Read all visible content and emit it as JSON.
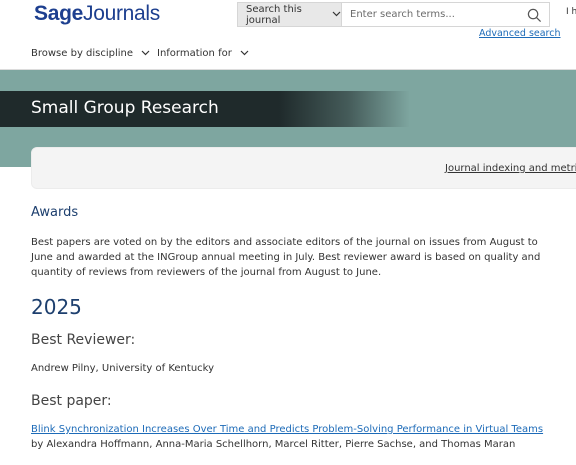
{
  "header": {
    "logo_bold": "Sage",
    "logo_thin": "Journals",
    "search_scope": "Search this journal",
    "search_placeholder": "Enter search terms...",
    "advanced_search": "Advanced search",
    "user_area_text": "I ha"
  },
  "nav": {
    "items": [
      {
        "label": "Browse by discipline"
      },
      {
        "label": "Information for"
      }
    ]
  },
  "banner": {
    "journal_title": "Small Group Research",
    "color": "#7ea6a0"
  },
  "tabbar": {
    "indexing_link": "Journal indexing and metrics"
  },
  "content": {
    "heading": "Awards",
    "intro": "Best papers are voted on by the editors and associate editors of the journal on issues from August to June and awarded at the INGroup annual meeting in July. Best reviewer award is based on quality and quantity of reviews from reviewers of the journal from August to June.",
    "year": "2025",
    "best_reviewer_heading": "Best Reviewer:",
    "best_reviewer": "Andrew Pilny, University of Kentucky",
    "best_paper_heading": "Best paper:",
    "paper_title": "Blink Synchronization Increases Over Time and Predicts Problem-Solving Performance in Virtual Teams",
    "paper_authors": "by Alexandra Hoffmann, Anna-Maria Schellhorn, Marcel Ritter, Pierre Sachse, and Thomas Maran"
  },
  "colors": {
    "brand_blue": "#1d3f8f",
    "link_blue": "#1d6bb8",
    "heading_navy": "#1d3f6e"
  }
}
